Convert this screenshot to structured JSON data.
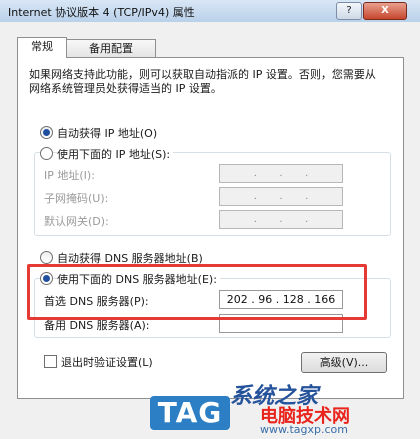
{
  "window": {
    "title": "Internet 协议版本 4 (TCP/IPv4) 属性",
    "help_label": "?",
    "close_label": "X"
  },
  "tabs": [
    {
      "label": "常规",
      "active": true
    },
    {
      "label": "备用配置",
      "active": false
    }
  ],
  "description": "如果网络支持此功能，则可以获取自动指派的 IP 设置。否则，您需要从网络系统管理员处获得适当的 IP 设置。",
  "ip": {
    "auto_label": "自动获得 IP 地址(O)",
    "manual_label": "使用下面的 IP 地址(S):",
    "fields": [
      {
        "label": "IP 地址(I):",
        "value": ""
      },
      {
        "label": "子网掩码(U):",
        "value": ""
      },
      {
        "label": "默认网关(D):",
        "value": ""
      }
    ]
  },
  "dns": {
    "auto_label": "自动获得 DNS 服务器地址(B)",
    "manual_label": "使用下面的 DNS 服务器地址(E):",
    "preferred_label": "首选 DNS 服务器(P):",
    "preferred_value": "202 . 96 . 128 . 166",
    "alternate_label": "备用 DNS 服务器(A):",
    "alternate_value": ""
  },
  "validate_label": "退出时验证设置(L)",
  "advanced_button": "高级(V)...",
  "watermark": {
    "tag": "TAG",
    "top": "系统之家",
    "cn": "电脑技术网",
    "url": "www.tagxp.com"
  },
  "colors": {
    "highlight": "#e43a33",
    "radio_dot": "#1f4f9e",
    "tag_blue": "#2c7fc4"
  }
}
